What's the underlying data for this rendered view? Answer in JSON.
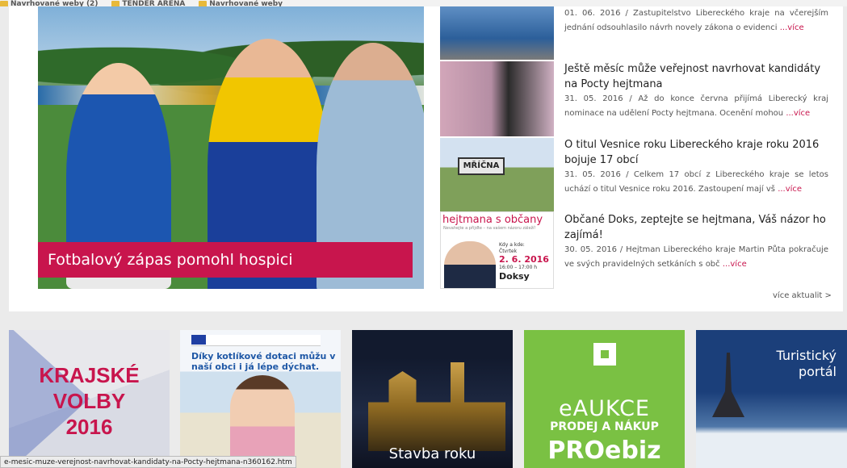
{
  "bookmarks": [
    "Navrhované weby (2)",
    "TENDER ARENA",
    "Navrhované weby"
  ],
  "hero": {
    "caption": "Fotbalový zápas pomohl hospici"
  },
  "news": [
    {
      "title": "",
      "date": "01. 06. 2016",
      "excerpt": "01. 06. 2016 / Zastupitelstvo Libereckého kraje na včerejším jednání odsouhlasilo návrh novely zákona o evidenci",
      "more": "...více"
    },
    {
      "title": "Ještě měsíc může veřejnost navrhovat kandidáty na Pocty hejtmana",
      "excerpt": "31. 05. 2016 / Až do konce června přijímá Liberecký kraj nominace na udělení Pocty hejtmana. Ocenění mohou",
      "more": "...více"
    },
    {
      "title": "O titul Vesnice roku Libereckého kraje roku 2016 bojuje 17 obcí",
      "excerpt": "31. 05. 2016 / Celkem 17 obcí z Libereckého kraje se letos uchází o titul Vesnice roku 2016. Zastoupení mají vš",
      "more": "...více"
    },
    {
      "title": "Občané Doks, zeptejte se hejtmana, Váš názor ho zajímá!",
      "excerpt": "30. 05. 2016 / Hejtman Libereckého kraje Martin Půta pokračuje ve svých pravidelných setkáních s obč",
      "more": "...více"
    }
  ],
  "thumb3": {
    "sign": "MŘÍČNA"
  },
  "thumb4": {
    "heading": "hejtmana s občany",
    "sub": "Nevahejte a přijďte – na vašem názoru záleží!",
    "kdy": "Kdy a kde:",
    "day": "Čtvrtek",
    "date": "2. 6. 2016",
    "time": "16:00 – 17:00 h",
    "city": "Doksy"
  },
  "all_news": "více aktualit >",
  "banners": {
    "b1": [
      "KRAJSKÉ",
      "VOLBY",
      "2016"
    ],
    "b2": "Díky kotlíkové dotaci můžu v naší obci i já lépe dýchat.",
    "b3": "Stavba roku",
    "b4": {
      "line1": "eAUKCE",
      "line2": "PRODEJ A NÁKUP",
      "line3": "PROebiz"
    },
    "b5": [
      "Turistický",
      "portál"
    ]
  },
  "status_url": "e-mesic-muze-verejnost-navrhovat-kandidaty-na-Pocty-hejtmana-n360162.htm",
  "colors": {
    "accent": "#c8154d",
    "green": "#7ac143",
    "link": "#c8154d"
  }
}
